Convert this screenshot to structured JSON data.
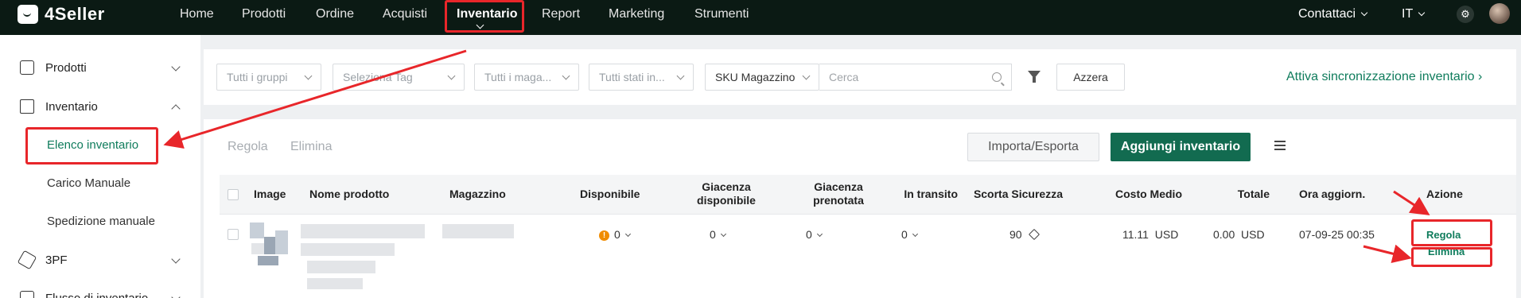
{
  "app": {
    "logo_text": "4Seller"
  },
  "topnav": {
    "items": [
      {
        "label": "Home"
      },
      {
        "label": "Prodotti"
      },
      {
        "label": "Ordine"
      },
      {
        "label": "Acquisti"
      },
      {
        "label": "Inventario"
      },
      {
        "label": "Report"
      },
      {
        "label": "Marketing"
      },
      {
        "label": "Strumenti"
      }
    ],
    "contact_label": "Contattaci",
    "language_label": "IT"
  },
  "sidebar": {
    "groups": [
      {
        "label": "Prodotti",
        "icon": "box-icon"
      },
      {
        "label": "Inventario",
        "icon": "warehouse-icon"
      },
      {
        "label": "3PF",
        "icon": "hexagon-icon"
      },
      {
        "label": "Flusso di inventario",
        "icon": "flow-icon"
      }
    ],
    "sub_items": [
      {
        "label": "Elenco inventario"
      },
      {
        "label": "Carico Manuale"
      },
      {
        "label": "Spedizione manuale"
      }
    ]
  },
  "filters": {
    "groups_placeholder": "Tutti i gruppi",
    "tag_placeholder": "Seleziona Tag",
    "warehouse_placeholder": "Tutti i maga...",
    "status_placeholder": "Tutti stati in...",
    "search_field": "SKU Magazzino",
    "search_placeholder": "Cerca",
    "reset_label": "Azzera",
    "sync_link": "Attiva sincronizzazione inventario"
  },
  "toolbar": {
    "adjust_label": "Regola",
    "delete_label": "Elimina",
    "import_export_label": "Importa/Esporta",
    "add_inventory_label": "Aggiungi inventario"
  },
  "table": {
    "headers": {
      "image": "Image",
      "product_name": "Nome prodotto",
      "warehouse": "Magazzino",
      "available": "Disponibile",
      "stock_available_1": "Giacenza",
      "stock_available_2": "disponibile",
      "stock_reserved_1": "Giacenza",
      "stock_reserved_2": "prenotata",
      "in_transit": "In transito",
      "safety_stock": "Scorta Sicurezza",
      "avg_cost": "Costo Medio",
      "total": "Totale",
      "updated": "Ora aggiorn.",
      "action": "Azione"
    },
    "rows": [
      {
        "available": "0",
        "stock_available": "0",
        "stock_reserved": "0",
        "in_transit": "0",
        "safety_stock": "90",
        "avg_cost": "11.11",
        "avg_cost_currency": "USD",
        "total": "0.00",
        "total_currency": "USD",
        "updated": "07-09-25 00:35",
        "action_adjust": "Regola",
        "action_delete": "Elimina"
      }
    ]
  },
  "colors": {
    "topbar": "#0b1a14",
    "accent": "#0f7c5c",
    "primary_button": "#126b50",
    "annotation": "#e8262a",
    "warning": "#f08c00"
  }
}
